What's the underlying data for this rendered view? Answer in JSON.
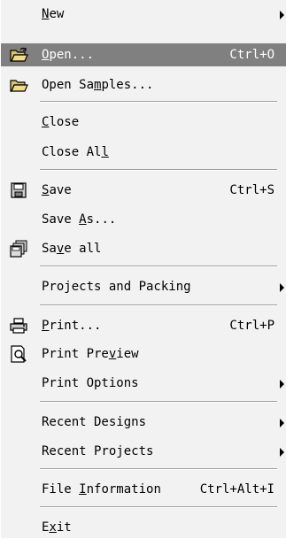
{
  "menu": {
    "items": [
      {
        "id": "new",
        "pre": "",
        "mn": "N",
        "post": "ew",
        "shortcut": "",
        "submenu": true,
        "icon": ""
      },
      {
        "id": "open",
        "pre": "",
        "mn": "O",
        "post": "pen...",
        "shortcut": "Ctrl+O",
        "submenu": false,
        "icon": "open-folder-icon",
        "selected": true
      },
      {
        "id": "open-samples",
        "pre": "Open Sa",
        "mn": "m",
        "post": "ples...",
        "shortcut": "",
        "submenu": false,
        "icon": "open-folder-icon"
      },
      {
        "id": "close",
        "pre": "",
        "mn": "C",
        "post": "lose",
        "shortcut": "",
        "submenu": false,
        "icon": ""
      },
      {
        "id": "close-all",
        "pre": "Close Al",
        "mn": "l",
        "post": "",
        "shortcut": "",
        "submenu": false,
        "icon": ""
      },
      {
        "id": "save",
        "pre": "",
        "mn": "S",
        "post": "ave",
        "shortcut": "Ctrl+S",
        "submenu": false,
        "icon": "floppy-disk-icon"
      },
      {
        "id": "save-as",
        "pre": "Save ",
        "mn": "A",
        "post": "s...",
        "shortcut": "",
        "submenu": false,
        "icon": ""
      },
      {
        "id": "save-all",
        "pre": "Sa",
        "mn": "v",
        "post": "e all",
        "shortcut": "",
        "submenu": false,
        "icon": "multiple-disks-icon"
      },
      {
        "id": "projects-packing",
        "pre": "Projects and Packing",
        "mn": "",
        "post": "",
        "shortcut": "",
        "submenu": true,
        "icon": ""
      },
      {
        "id": "print",
        "pre": "",
        "mn": "P",
        "post": "rint...",
        "shortcut": "Ctrl+P",
        "submenu": false,
        "icon": "printer-icon"
      },
      {
        "id": "print-preview",
        "pre": "Print Pre",
        "mn": "v",
        "post": "iew",
        "shortcut": "",
        "submenu": false,
        "icon": "print-preview-icon"
      },
      {
        "id": "print-options",
        "pre": "Print Options",
        "mn": "",
        "post": "",
        "shortcut": "",
        "submenu": true,
        "icon": ""
      },
      {
        "id": "recent-designs",
        "pre": "Recent Designs",
        "mn": "",
        "post": "",
        "shortcut": "",
        "submenu": true,
        "icon": ""
      },
      {
        "id": "recent-projects",
        "pre": "Recent Projects",
        "mn": "",
        "post": "",
        "shortcut": "",
        "submenu": true,
        "icon": ""
      },
      {
        "id": "file-information",
        "pre": "File ",
        "mn": "I",
        "post": "nformation",
        "shortcut": "Ctrl+Alt+I",
        "submenu": false,
        "icon": ""
      },
      {
        "id": "exit",
        "pre": "E",
        "mn": "x",
        "post": "it",
        "shortcut": "",
        "submenu": false,
        "icon": ""
      }
    ]
  },
  "colors": {
    "menu_bg": "#f2f2f2",
    "selected_bg": "#808080",
    "selected_text": "#ffffff",
    "separator": "#a0a0a0"
  }
}
